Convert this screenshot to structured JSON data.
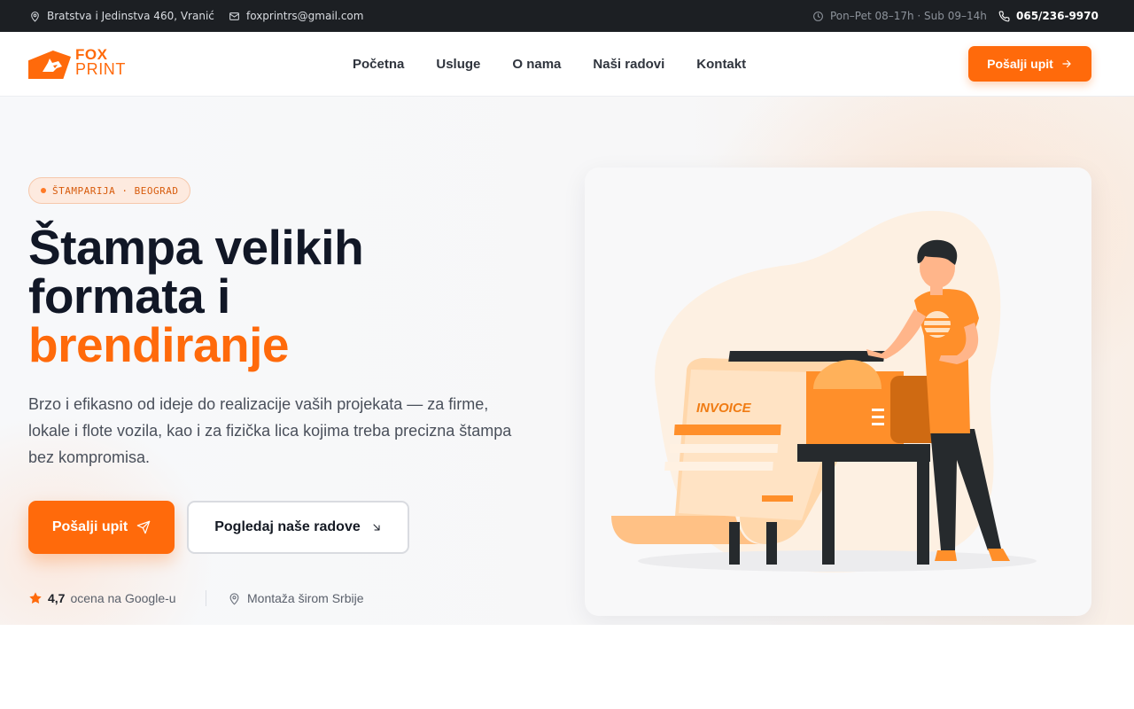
{
  "topbar": {
    "address": "Bratstva i Jedinstva 460, Vranić",
    "email": "foxprintrs@gmail.com",
    "hours": "Pon–Pet 08–17h · Sub 09–14h",
    "phone": "065/236-9970"
  },
  "header": {
    "logo_top": "FOX",
    "logo_bottom": "PRINT",
    "nav": [
      "Početna",
      "Usluge",
      "O nama",
      "Naši radovi",
      "Kontakt"
    ],
    "cta_label": "Pošalji upit"
  },
  "hero": {
    "badge": "ŠTAMPARIJA · BEOGRAD",
    "title_line1": "Štampa velikih",
    "title_line2": "formata i",
    "title_accent": "brendiranje",
    "lead": "Brzo i efikasno od ideje do realizacije vaših projekata — za firme, lokale i flote vozila, kao i za fizička lica kojima treba precizna štampa bez kompromisa.",
    "primary_button": "Pošalji upit",
    "secondary_button": "Pogledaj naše radove",
    "rating_value": "4,7",
    "rating_label": "ocena na Google-u",
    "montaza": "Montaža širom Srbije"
  },
  "illustration": {
    "invoice_label": "INVOICE"
  },
  "colors": {
    "accent": "#ff6a0b",
    "dark": "#1c1f23",
    "heading": "#111726"
  }
}
